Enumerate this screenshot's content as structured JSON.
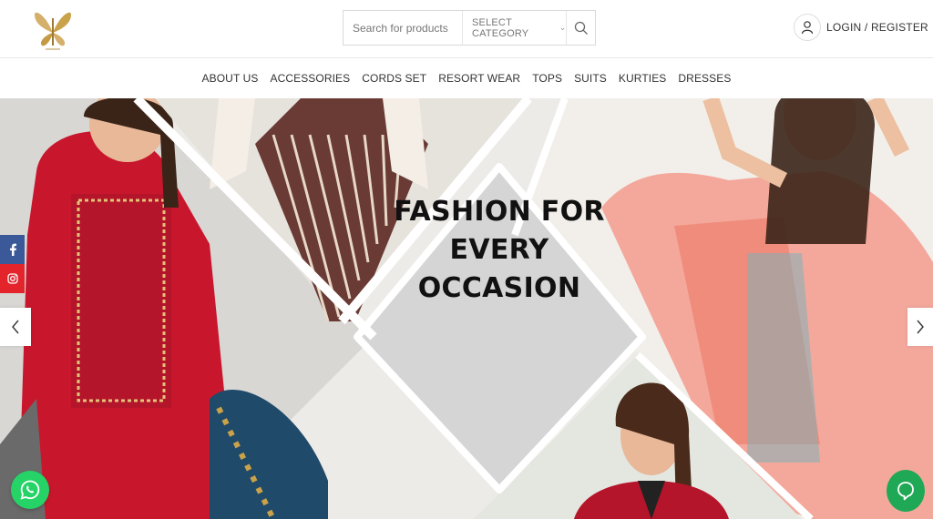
{
  "header": {
    "search": {
      "placeholder": "Search for products",
      "category": "SELECT CATEGORY"
    },
    "account_label": "LOGIN / REGISTER"
  },
  "nav": {
    "items": [
      "ABOUT US",
      "ACCESSORIES",
      "CORDS SET",
      "RESORT WEAR",
      "TOPS",
      "SUITS",
      "KURTIES",
      "DRESSES"
    ]
  },
  "hero": {
    "headline": [
      "FASHION FOR",
      "EVERY",
      "OCCASION"
    ]
  },
  "social": {
    "facebook_icon": "facebook-icon",
    "instagram_icon": "instagram-icon"
  },
  "colors": {
    "accent": "#c9a24a",
    "facebook": "#3b5998",
    "instagram": "#e3242b",
    "whatsapp": "#25d366",
    "chat": "#1fa855"
  }
}
